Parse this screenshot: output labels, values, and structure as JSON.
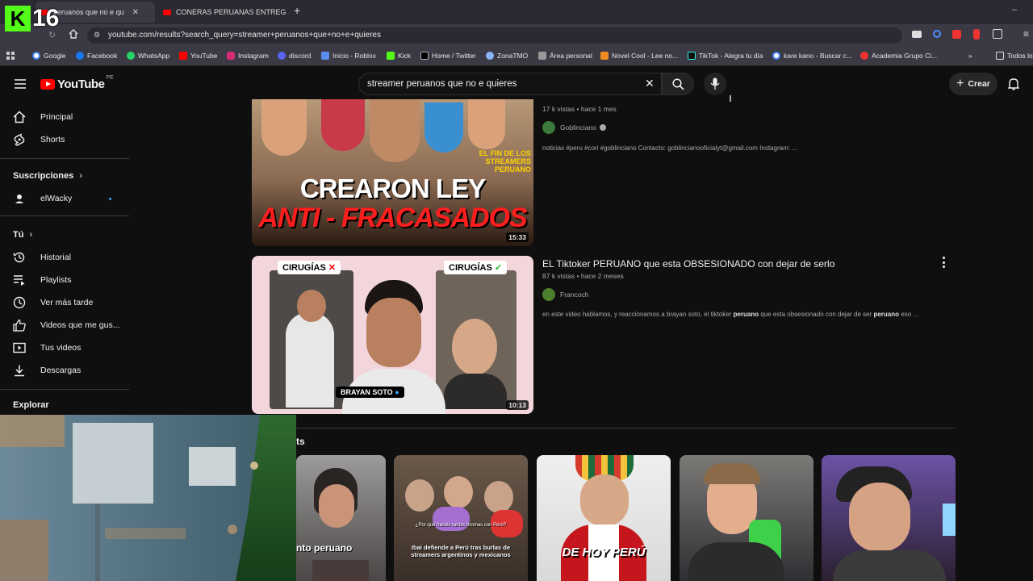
{
  "overlay": {
    "logo_letter": "K",
    "number": "16"
  },
  "browser": {
    "tabs": [
      {
        "label": "peruanos que no e qu",
        "active": true
      },
      {
        "label": "CONERAS PERUANAS ENTREG",
        "active": false
      }
    ],
    "url": "youtube.com/results?search_query=streamer+peruanos+que+no+e+quieres",
    "bookmarks": [
      "Google",
      "Facebook",
      "WhatsApp",
      "YouTube",
      "Instagram",
      "discord",
      "Inicio - Roblox",
      "Kick",
      "Home / Twitter",
      "ZonaTMO",
      "Área personal",
      "Novel Cool - Lee no...",
      "TikTok - Alegra tu día",
      "kare kano - Buscar c...",
      "Academia Grupo Ci..."
    ],
    "all_bookmarks_label": "Todos lo",
    "colors": {
      "tabbar": "#2b2a33",
      "toolbar": "#3b3a44"
    }
  },
  "youtube": {
    "logo_text": "YouTube",
    "country": "PE",
    "search_query": "streamer peruanos que no e quieres",
    "create_label": "Crear",
    "accent": "#ff0000"
  },
  "sidebar": {
    "main": [
      {
        "label": "Principal",
        "icon": "home-icon"
      },
      {
        "label": "Shorts",
        "icon": "shorts-icon"
      }
    ],
    "subscriptions_header": "Suscripciones",
    "subscriptions": [
      {
        "label": "elWacky"
      }
    ],
    "you_header": "Tú",
    "you": [
      {
        "label": "Historial",
        "icon": "history-icon"
      },
      {
        "label": "Playlists",
        "icon": "playlists-icon"
      },
      {
        "label": "Ver más tarde",
        "icon": "watch-later-icon"
      },
      {
        "label": "Videos que me gus...",
        "icon": "like-icon"
      },
      {
        "label": "Tus videos",
        "icon": "your-videos-icon"
      },
      {
        "label": "Descargas",
        "icon": "download-icon"
      }
    ],
    "explore_header": "Explorar"
  },
  "results": [
    {
      "thumb_top_text": "EL FIN DE LOS STREAMERS PERUANO",
      "thumb_big_1": "CREARON LEY",
      "thumb_big_2": "ANTI - FRACASADOS",
      "duration": "15:33",
      "meta": "17 k vistas • hace 1 mes",
      "channel": "Goblinciano",
      "verified": true,
      "description": "noticias #peru #cori #goblinciano Contacto: goblincianooficialyt@gmail.com Instagram: ..."
    },
    {
      "title": "EL Tiktoker PERUANO que esta OBSESIONADO con dejar de serlo",
      "thumb_label_1": "CIRUGÍAS",
      "thumb_label_2": "CIRUGÍAS",
      "thumb_tag": "BRAYAN SOTO",
      "duration": "10:13",
      "meta": "87 k vistas • hace 2 meses",
      "channel": "Francoch",
      "description_parts": [
        "en este video hablamos, y reaccionamos a brayan soto, el tiktoker ",
        "peruano",
        " que esta obsesionado con dejar de ser ",
        "peruano",
        " eso ..."
      ]
    }
  ],
  "shorts": {
    "header": "ts",
    "items": [
      {
        "caption": "nto peruano"
      },
      {
        "caption": "Ibai defiende a Perú tras burlas de streamers argentinos y mexicanos",
        "question": "¿Por qué haceis tantas bromas con Perú?"
      },
      {
        "caption": "DE HOY PERÚ"
      },
      {
        "caption": ""
      },
      {
        "caption": ""
      }
    ]
  }
}
